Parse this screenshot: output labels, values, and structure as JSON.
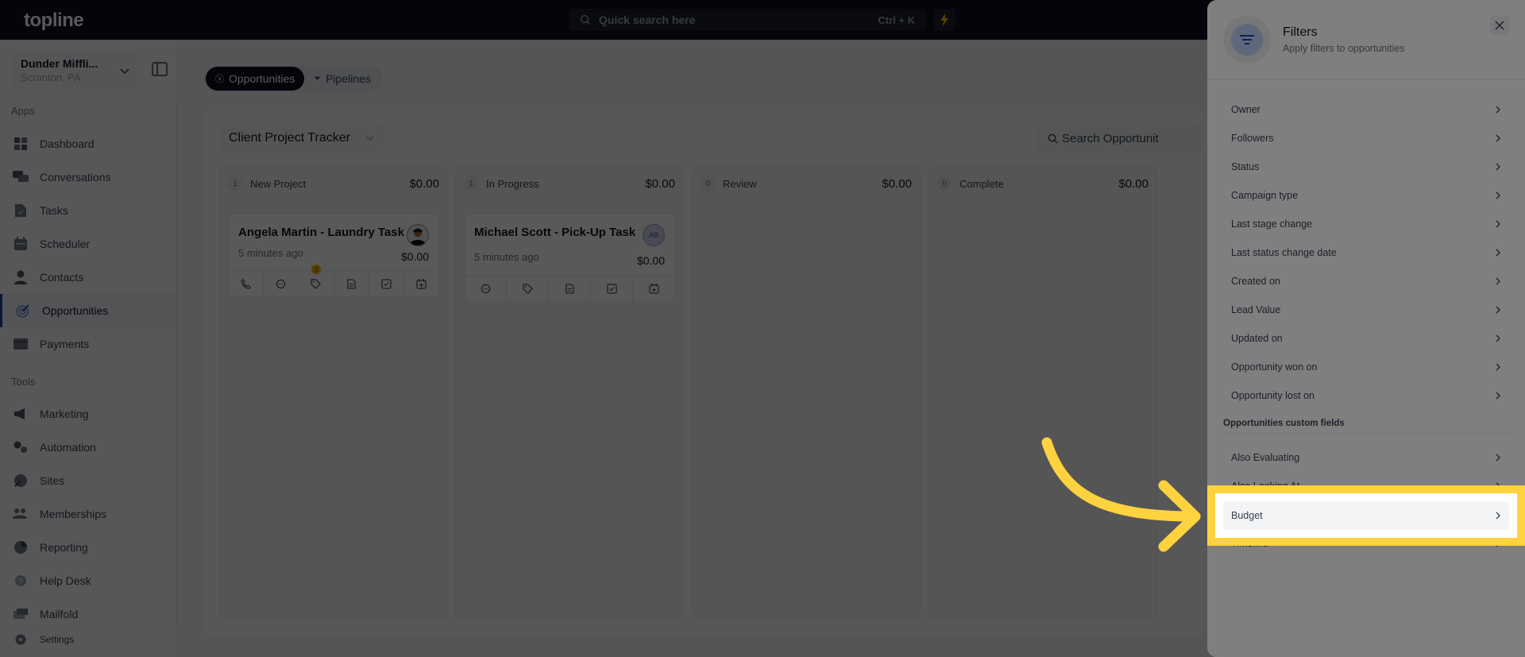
{
  "topbar": {
    "logo": "topline",
    "search_placeholder": "Quick search here",
    "search_shortcut": "Ctrl + K",
    "bolt_icon": "lightning-icon"
  },
  "sidebar": {
    "location": {
      "name": "Dunder Miffli...",
      "city": "Scranton, PA"
    },
    "apps_label": "Apps",
    "apps": [
      {
        "label": "Dashboard",
        "icon": "dashboard-icon"
      },
      {
        "label": "Conversations",
        "icon": "chat-icon"
      },
      {
        "label": "Tasks",
        "icon": "task-icon"
      },
      {
        "label": "Scheduler",
        "icon": "calendar-icon"
      },
      {
        "label": "Contacts",
        "icon": "user-icon"
      },
      {
        "label": "Opportunities",
        "icon": "target-icon",
        "active": true
      },
      {
        "label": "Payments",
        "icon": "card-icon"
      }
    ],
    "tools_label": "Tools",
    "tools": [
      {
        "label": "Marketing",
        "icon": "megaphone-icon"
      },
      {
        "label": "Automation",
        "icon": "gears-icon"
      },
      {
        "label": "Sites",
        "icon": "globe-icon"
      },
      {
        "label": "Memberships",
        "icon": "users-icon"
      },
      {
        "label": "Reporting",
        "icon": "pie-icon"
      },
      {
        "label": "Help Desk",
        "icon": "help-icon"
      },
      {
        "label": "Mailfold",
        "icon": "mail-icon"
      }
    ],
    "settings_label": "Settings"
  },
  "main": {
    "tabs": [
      {
        "label": "Opportunities",
        "active": true
      },
      {
        "label": "Pipelines",
        "active": false
      }
    ],
    "pipeline_select": "Client Project Tracker",
    "search_placeholder": "Search Opportunit",
    "columns": [
      {
        "count": "1",
        "name": "New Project",
        "amount": "$0.00",
        "cards": [
          {
            "title": "Angela Martin - Laundry Task",
            "time": "5 minutes ago",
            "value": "$0.00",
            "avatar": "photo",
            "tag_badge": "3"
          }
        ]
      },
      {
        "count": "1",
        "name": "In Progress",
        "amount": "$0.00",
        "cards": [
          {
            "title": "Michael Scott - Pick-Up Task",
            "time": "5 minutes ago",
            "value": "$0.00",
            "avatar": "AB"
          }
        ]
      },
      {
        "count": "0",
        "name": "Review",
        "amount": "$0.00",
        "cards": []
      },
      {
        "count": "0",
        "name": "Complete",
        "amount": "$0.00",
        "cards": []
      }
    ]
  },
  "filters": {
    "title": "Filters",
    "subtitle": "Apply filters to opportunities",
    "items": [
      "Owner",
      "Followers",
      "Status",
      "Campaign type",
      "Last stage change",
      "Last status change date",
      "Created on",
      "Lead Value",
      "Updated on",
      "Opportunity won on",
      "Opportunity lost on"
    ],
    "custom_section": "Opportunities custom fields",
    "custom_items": [
      "Also Evaluating",
      "Also Looking At",
      "Budget",
      "Timeline"
    ],
    "highlighted": "Budget"
  },
  "colors": {
    "highlight": "#ffd23f",
    "brand_dark": "#0b1022",
    "accent_blue": "#1e40af"
  }
}
